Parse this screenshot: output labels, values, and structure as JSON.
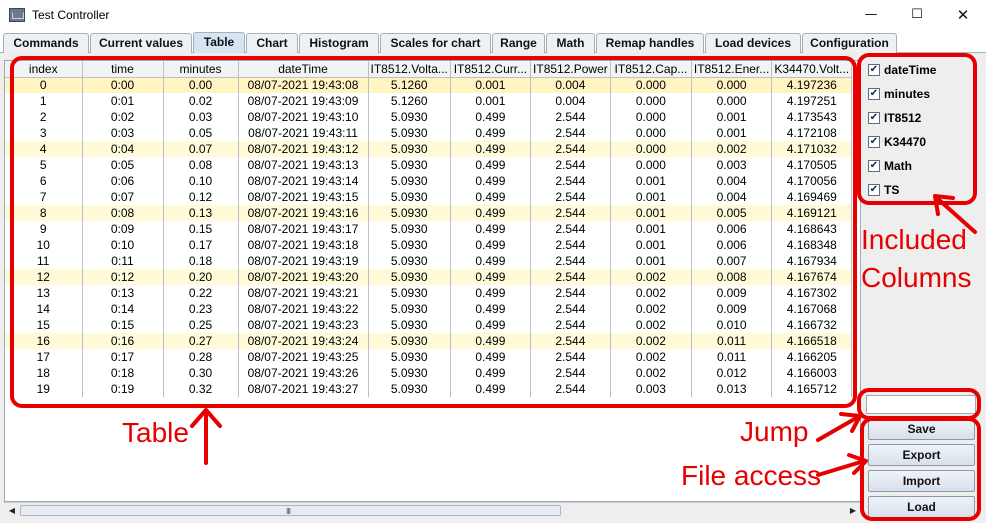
{
  "window": {
    "title": "Test Controller",
    "min_glyph": "—",
    "max_glyph": "☐",
    "close_glyph": "✕"
  },
  "tabs": [
    {
      "label": "Commands"
    },
    {
      "label": "Current values"
    },
    {
      "label": "Table",
      "active": true
    },
    {
      "label": "Chart"
    },
    {
      "label": "Histogram"
    },
    {
      "label": "Scales for chart"
    },
    {
      "label": "Range"
    },
    {
      "label": "Math"
    },
    {
      "label": "Remap handles"
    },
    {
      "label": "Load devices"
    },
    {
      "label": "Configuration"
    }
  ],
  "table": {
    "columns": [
      "index",
      "time",
      "minutes",
      "dateTime",
      "IT8512.Volta...",
      "IT8512.Curr...",
      "IT8512.Power",
      "IT8512.Cap...",
      "IT8512.Ener...",
      "K34470.Volt..."
    ],
    "rows": [
      [
        "0",
        "0:00",
        "0.00",
        "08/07-2021 19:43:08",
        "5.1260",
        "0.001",
        "0.004",
        "0.000",
        "0.000",
        "4.197236"
      ],
      [
        "1",
        "0:01",
        "0.02",
        "08/07-2021 19:43:09",
        "5.1260",
        "0.001",
        "0.004",
        "0.000",
        "0.000",
        "4.197251"
      ],
      [
        "2",
        "0:02",
        "0.03",
        "08/07-2021 19:43:10",
        "5.0930",
        "0.499",
        "2.544",
        "0.000",
        "0.001",
        "4.173543"
      ],
      [
        "3",
        "0:03",
        "0.05",
        "08/07-2021 19:43:11",
        "5.0930",
        "0.499",
        "2.544",
        "0.000",
        "0.001",
        "4.172108"
      ],
      [
        "4",
        "0:04",
        "0.07",
        "08/07-2021 19:43:12",
        "5.0930",
        "0.499",
        "2.544",
        "0.000",
        "0.002",
        "4.171032"
      ],
      [
        "5",
        "0:05",
        "0.08",
        "08/07-2021 19:43:13",
        "5.0930",
        "0.499",
        "2.544",
        "0.000",
        "0.003",
        "4.170505"
      ],
      [
        "6",
        "0:06",
        "0.10",
        "08/07-2021 19:43:14",
        "5.0930",
        "0.499",
        "2.544",
        "0.001",
        "0.004",
        "4.170056"
      ],
      [
        "7",
        "0:07",
        "0.12",
        "08/07-2021 19:43:15",
        "5.0930",
        "0.499",
        "2.544",
        "0.001",
        "0.004",
        "4.169469"
      ],
      [
        "8",
        "0:08",
        "0.13",
        "08/07-2021 19:43:16",
        "5.0930",
        "0.499",
        "2.544",
        "0.001",
        "0.005",
        "4.169121"
      ],
      [
        "9",
        "0:09",
        "0.15",
        "08/07-2021 19:43:17",
        "5.0930",
        "0.499",
        "2.544",
        "0.001",
        "0.006",
        "4.168643"
      ],
      [
        "10",
        "0:10",
        "0.17",
        "08/07-2021 19:43:18",
        "5.0930",
        "0.499",
        "2.544",
        "0.001",
        "0.006",
        "4.168348"
      ],
      [
        "11",
        "0:11",
        "0.18",
        "08/07-2021 19:43:19",
        "5.0930",
        "0.499",
        "2.544",
        "0.001",
        "0.007",
        "4.167934"
      ],
      [
        "12",
        "0:12",
        "0.20",
        "08/07-2021 19:43:20",
        "5.0930",
        "0.499",
        "2.544",
        "0.002",
        "0.008",
        "4.167674"
      ],
      [
        "13",
        "0:13",
        "0.22",
        "08/07-2021 19:43:21",
        "5.0930",
        "0.499",
        "2.544",
        "0.002",
        "0.009",
        "4.167302"
      ],
      [
        "14",
        "0:14",
        "0.23",
        "08/07-2021 19:43:22",
        "5.0930",
        "0.499",
        "2.544",
        "0.002",
        "0.009",
        "4.167068"
      ],
      [
        "15",
        "0:15",
        "0.25",
        "08/07-2021 19:43:23",
        "5.0930",
        "0.499",
        "2.544",
        "0.002",
        "0.010",
        "4.166732"
      ],
      [
        "16",
        "0:16",
        "0.27",
        "08/07-2021 19:43:24",
        "5.0930",
        "0.499",
        "2.544",
        "0.002",
        "0.011",
        "4.166518"
      ],
      [
        "17",
        "0:17",
        "0.28",
        "08/07-2021 19:43:25",
        "5.0930",
        "0.499",
        "2.544",
        "0.002",
        "0.011",
        "4.166205"
      ],
      [
        "18",
        "0:18",
        "0.30",
        "08/07-2021 19:43:26",
        "5.0930",
        "0.499",
        "2.544",
        "0.002",
        "0.012",
        "4.166003"
      ],
      [
        "19",
        "0:19",
        "0.32",
        "08/07-2021 19:43:27",
        "5.0930",
        "0.499",
        "2.544",
        "0.003",
        "0.013",
        "4.165712"
      ]
    ],
    "highlighted_rows": [
      0,
      4,
      8,
      12,
      16
    ],
    "highlight_color": "#fffbd9"
  },
  "column_checklist": {
    "items": [
      {
        "label": "dateTime",
        "checked": true
      },
      {
        "label": "minutes",
        "checked": true
      },
      {
        "label": "IT8512",
        "checked": true
      },
      {
        "label": "K34470",
        "checked": true
      },
      {
        "label": "Math",
        "checked": true
      },
      {
        "label": "TS",
        "checked": true
      }
    ],
    "check_glyph": "✔"
  },
  "jump": {
    "value": ""
  },
  "file_buttons": {
    "save": "Save",
    "export": "Export",
    "import": "Import",
    "load": "Load"
  },
  "scroll": {
    "left_glyph": "◀",
    "right_glyph": "▶",
    "grip": "III"
  },
  "annotations": {
    "color": "#e60000",
    "table": "Table",
    "jump": "Jump",
    "file_access": "File access",
    "included_columns_line1": "Included",
    "included_columns_line2": "Columns"
  }
}
